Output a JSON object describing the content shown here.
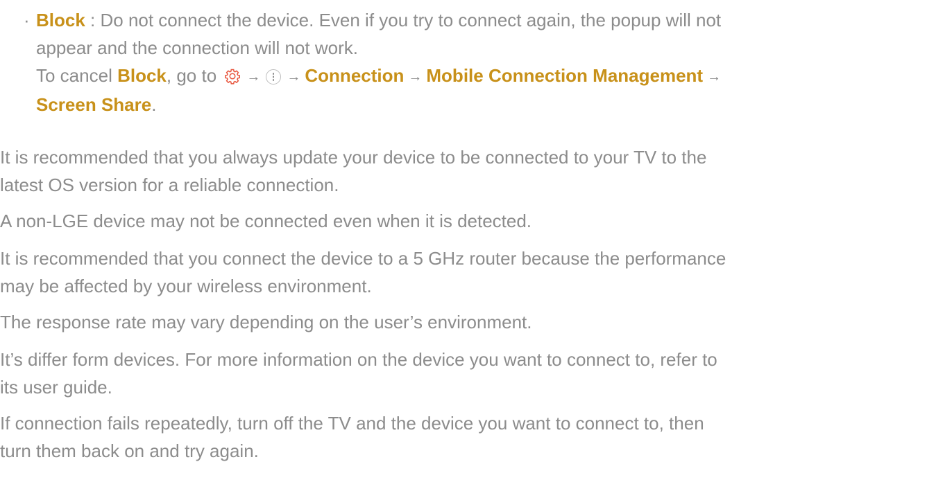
{
  "block_item": {
    "bullet": "·",
    "term": "Block",
    "desc_line1": " : Do not connect the device. Even if you try to connect again, the popup will not",
    "desc_line2": "appear and the connection will not work.",
    "cancel_prefix": "To cancel ",
    "cancel_term": "Block",
    "cancel_mid": ", go to ",
    "path_connection": "Connection",
    "path_mobile": "Mobile Connection Management",
    "path_screen_share": "Screen Share",
    "end_period": ".",
    "settings_icon": "settings-gear-icon",
    "more_icon": "more-options-icon",
    "arrow": "→"
  },
  "notes": {
    "n1_l1": "It is recommended that you always update your device to be connected to your TV to the",
    "n1_l2": "latest OS version for a reliable connection.",
    "n2_l1": "A non-LGE device may not be connected even when it is detected.",
    "n3_l1": "It is recommended that you connect the device to a 5 GHz router because the performance",
    "n3_l2": "may be affected by your wireless environment.",
    "n4_l1": "The response rate may vary depending on the user’s environment.",
    "n5_l1": "It’s differ form devices. For more information on the device you want to connect to, refer to",
    "n5_l2": "its user guide.",
    "n6_l1": "If connection fails repeatedly, turn off the TV and the device you want to connect to, then",
    "n6_l2": "turn them back on and try again."
  },
  "colors": {
    "text": "#8c8c8c",
    "highlight": "#c8911a",
    "gear": "#e8553d"
  }
}
